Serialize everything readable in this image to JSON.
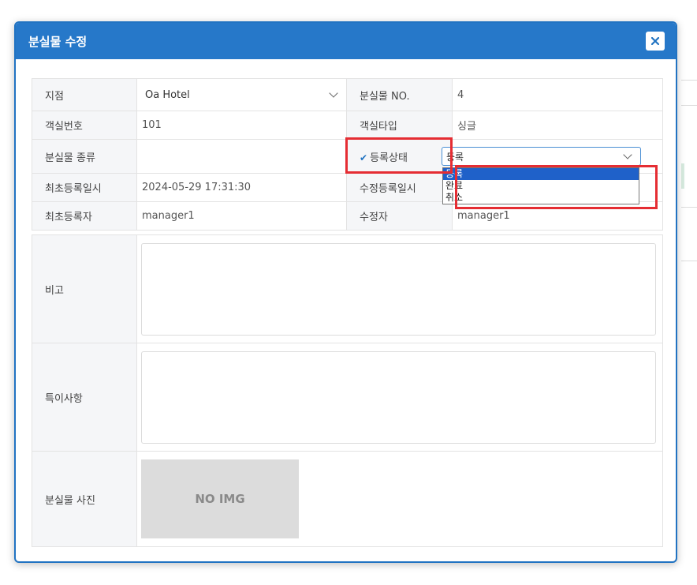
{
  "modal": {
    "title": "분실물 수정"
  },
  "fields": {
    "branch": {
      "label": "지점",
      "value": "Oa Hotel"
    },
    "lost_no": {
      "label": "분실물 NO.",
      "value": "4"
    },
    "room_no": {
      "label": "객실번호",
      "value": "101"
    },
    "room_type": {
      "label": "객실타입",
      "value": "싱글"
    },
    "item_type": {
      "label": "분실물 종류",
      "value": ""
    },
    "reg_status": {
      "label": "등록상태",
      "value": "등록",
      "options": [
        "등록",
        "완료",
        "취소"
      ]
    },
    "first_reg_time": {
      "label": "최초등록일시",
      "value": "2024-05-29 17:31:30"
    },
    "mod_reg_time": {
      "label": "수정등록일시",
      "value": ""
    },
    "first_reg_user": {
      "label": "최초등록자",
      "value": "manager1"
    },
    "modifier": {
      "label": "수정자",
      "value": "manager1"
    },
    "remarks": {
      "label": "비고",
      "value": ""
    },
    "special_notes": {
      "label": "특이사항",
      "value": ""
    },
    "photo": {
      "label": "분실물 사진",
      "placeholder": "NO IMG"
    }
  },
  "colors": {
    "header": "#2678c9",
    "highlight": "#e52d33",
    "selected_option": "#1f61c9"
  },
  "icons": {
    "close": "close-icon",
    "check": "check-icon",
    "dropdown": "chevron-down-icon"
  }
}
